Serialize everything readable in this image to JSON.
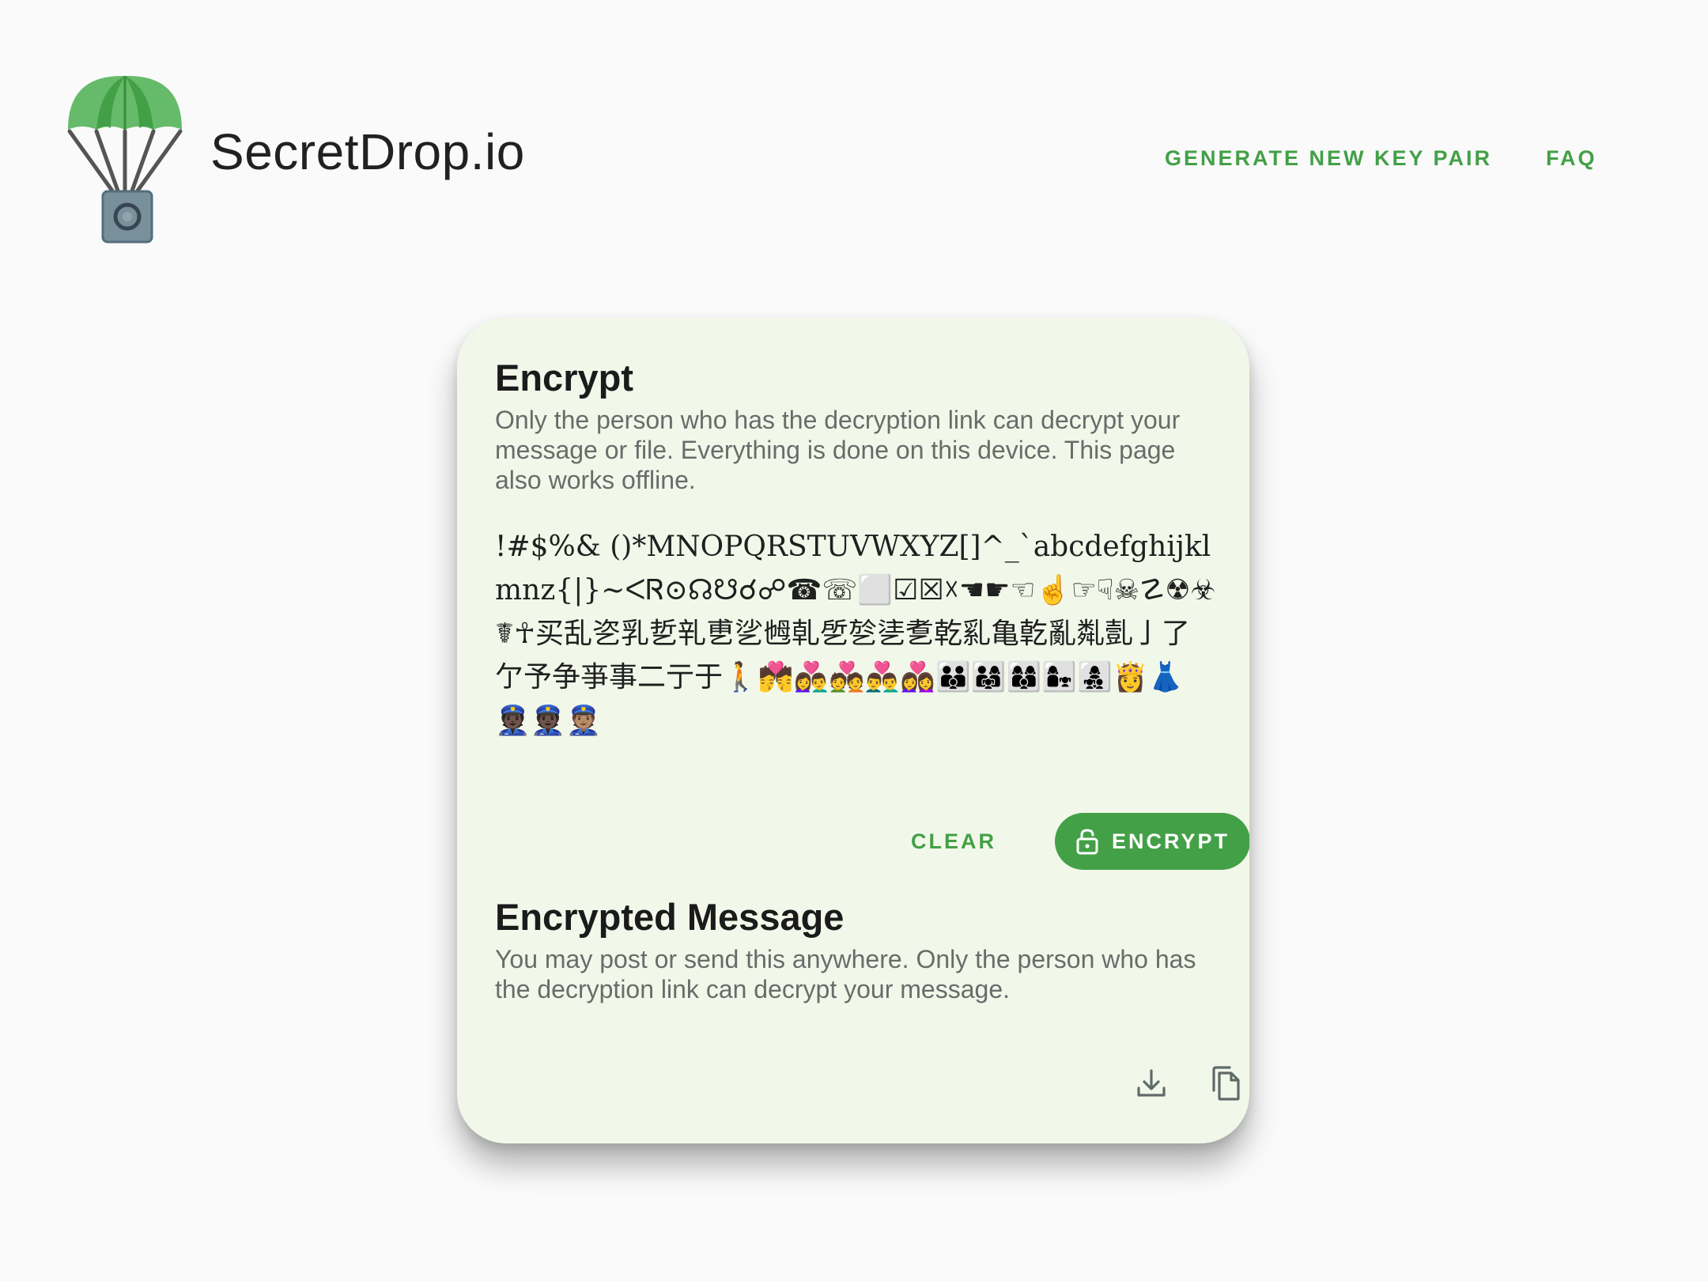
{
  "header": {
    "brand": "SecretDrop.io",
    "nav": {
      "generate_label": "GENERATE NEW KEY PAIR",
      "faq_label": "FAQ"
    }
  },
  "encrypt": {
    "title": "Encrypt",
    "description": "Only the person who has the decryption link can decrypt your message or file. Everything is done on this device. This page also works offline.",
    "message": "!#$%& ()*MNOPQRSTUVWXYZ[]^_`abcdefghijklmnz{|}~ᐸᏒ⊙☊☋☌☍☎☏⬜☑☒☓☚☛☜☝☞☟☠☡☢☣☤☥买乱乲乳乴乵乶乷乸乹乺乻乼乽乾乿亀亁亂亃亄亅了亇予争亊事二亍于🚶💏👩‍❤️‍👨💑👨‍❤️‍👨👩‍❤️‍👩👪👨‍👩‍👧👩‍👩‍👦👩‍👧👩‍👧‍👦👸👗👮🏿👮🏿👮🏽",
    "clear_label": "CLEAR",
    "encrypt_label": "ENCRYPT"
  },
  "encrypted": {
    "title": "Encrypted Message",
    "description": "You may post or send this anywhere. Only the person who has the decryption link can decrypt your message."
  },
  "icons": {
    "logo": "parachute-icon",
    "lock": "lock-open-icon",
    "download": "download-icon",
    "copy": "copy-icon"
  },
  "colors": {
    "accent": "#43a047",
    "card_bg": "#f2f8e9",
    "page_bg": "#fafafa"
  }
}
